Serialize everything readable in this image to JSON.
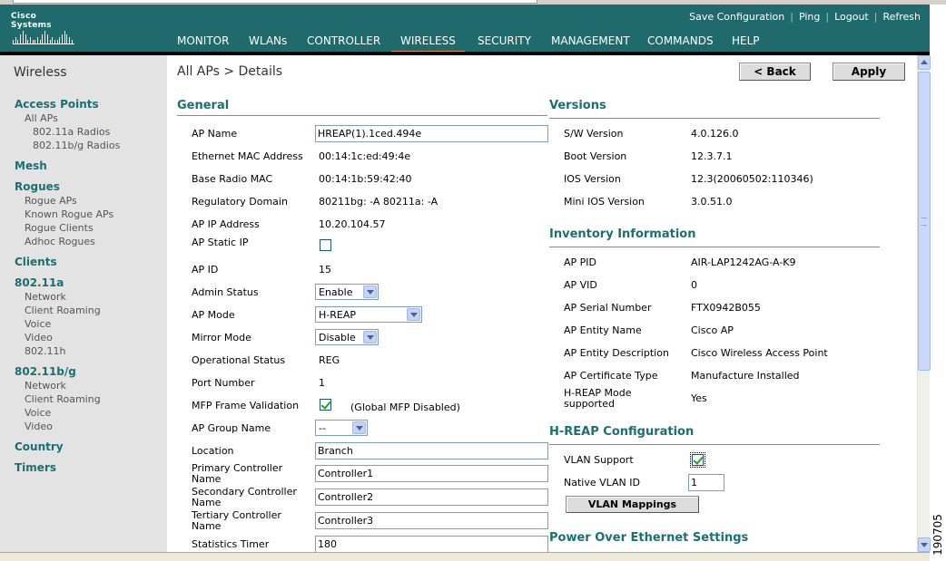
{
  "brand": {
    "name": "Cisco Systems"
  },
  "toplinks": [
    "Save Configuration",
    "Ping",
    "Logout",
    "Refresh"
  ],
  "nav": [
    "MONITOR",
    "WLANs",
    "CONTROLLER",
    "WIRELESS",
    "SECURITY",
    "MANAGEMENT",
    "COMMANDS",
    "HELP"
  ],
  "nav_active": "WIRELESS",
  "colors": {
    "header": "#1f6a6c",
    "accent": "#f08c1a",
    "section": "#1a6f72",
    "sidebar_bg": "#e3e3e3"
  },
  "sidebar": {
    "title": "Wireless",
    "items": [
      {
        "label": "Access Points",
        "level": "sec"
      },
      {
        "label": "All APs",
        "level": "l1"
      },
      {
        "label": "802.11a Radios",
        "level": "l2"
      },
      {
        "label": "802.11b/g Radios",
        "level": "l2"
      },
      {
        "label": "Mesh",
        "level": "sec"
      },
      {
        "label": "Rogues",
        "level": "sec"
      },
      {
        "label": "Rogue APs",
        "level": "l1"
      },
      {
        "label": "Known Rogue APs",
        "level": "l1"
      },
      {
        "label": "Rogue Clients",
        "level": "l1"
      },
      {
        "label": "Adhoc Rogues",
        "level": "l1"
      },
      {
        "label": "Clients",
        "level": "sec"
      },
      {
        "label": "802.11a",
        "level": "sec"
      },
      {
        "label": "Network",
        "level": "l1"
      },
      {
        "label": "Client Roaming",
        "level": "l1"
      },
      {
        "label": "Voice",
        "level": "l1"
      },
      {
        "label": "Video",
        "level": "l1"
      },
      {
        "label": "802.11h",
        "level": "l1"
      },
      {
        "label": "802.11b/g",
        "level": "sec"
      },
      {
        "label": "Network",
        "level": "l1"
      },
      {
        "label": "Client Roaming",
        "level": "l1"
      },
      {
        "label": "Voice",
        "level": "l1"
      },
      {
        "label": "Video",
        "level": "l1"
      },
      {
        "label": "Country",
        "level": "sec"
      },
      {
        "label": "Timers",
        "level": "sec"
      }
    ]
  },
  "page": {
    "breadcrumb": "All APs > Details",
    "back_label": "< Back",
    "apply_label": "Apply"
  },
  "general": {
    "title": "General",
    "fields": [
      {
        "label": "AP Name",
        "type": "text",
        "value": "HREAP(1).1ced.494e"
      },
      {
        "label": "Ethernet MAC Address",
        "type": "static",
        "value": "00:14:1c:ed:49:4e"
      },
      {
        "label": "Base Radio MAC",
        "type": "static",
        "value": "00:14:1b:59:42:40"
      },
      {
        "label": "Regulatory Domain",
        "type": "static",
        "value": "80211bg: -A 80211a: -A"
      },
      {
        "label": "AP IP Address",
        "type": "static",
        "value": "10.20.104.57"
      },
      {
        "label": "AP Static IP",
        "type": "checkbox",
        "checked": false
      },
      {
        "label": "AP ID",
        "type": "static",
        "value": "15"
      },
      {
        "label": "Admin Status",
        "type": "select",
        "value": "Enable"
      },
      {
        "label": "AP Mode",
        "type": "select",
        "value": "H-REAP"
      },
      {
        "label": "Mirror Mode",
        "type": "select",
        "value": "Disable"
      },
      {
        "label": "Operational Status",
        "type": "static",
        "value": "REG"
      },
      {
        "label": "Port Number",
        "type": "static",
        "value": "1"
      },
      {
        "label": "MFP Frame Validation",
        "type": "checkbox",
        "checked": true,
        "note": "(Global MFP Disabled)"
      },
      {
        "label": "AP Group Name",
        "type": "select",
        "value": "--"
      },
      {
        "label": "Location",
        "type": "text",
        "value": "Branch"
      },
      {
        "label": "Primary Controller Name",
        "type": "text",
        "value": "Controller1"
      },
      {
        "label": "Secondary Controller Name",
        "type": "text",
        "value": "Controller2"
      },
      {
        "label": "Tertiary Controller Name",
        "type": "text",
        "value": "Controller3"
      },
      {
        "label": "Statistics Timer",
        "type": "text",
        "value": "180"
      }
    ]
  },
  "versions": {
    "title": "Versions",
    "fields": [
      {
        "label": "S/W Version",
        "value": "4.0.126.0"
      },
      {
        "label": "Boot Version",
        "value": "12.3.7.1"
      },
      {
        "label": "IOS Version",
        "value": "12.3(20060502:110346)"
      },
      {
        "label": "Mini IOS Version",
        "value": "3.0.51.0"
      }
    ]
  },
  "inventory": {
    "title": "Inventory Information",
    "fields": [
      {
        "label": "AP PID",
        "value": "AIR-LAP1242AG-A-K9"
      },
      {
        "label": "AP VID",
        "value": "0"
      },
      {
        "label": "AP Serial Number",
        "value": "FTX0942B055"
      },
      {
        "label": "AP Entity Name",
        "value": "Cisco AP"
      },
      {
        "label": "AP Entity Description",
        "value": "Cisco Wireless Access Point"
      },
      {
        "label": "AP Certificate Type",
        "value": "Manufacture Installed"
      },
      {
        "label": "H-REAP Mode supported",
        "value": "Yes"
      }
    ]
  },
  "hreap": {
    "title": "H-REAP Configuration",
    "vlan_support_label": "VLAN Support",
    "vlan_support_checked": true,
    "native_vlan_label": "Native VLAN ID",
    "native_vlan_value": "1",
    "vlan_mappings_label": "VLAN Mappings"
  },
  "poe": {
    "title": "Power Over Ethernet Settings"
  },
  "figure_id": "190705"
}
